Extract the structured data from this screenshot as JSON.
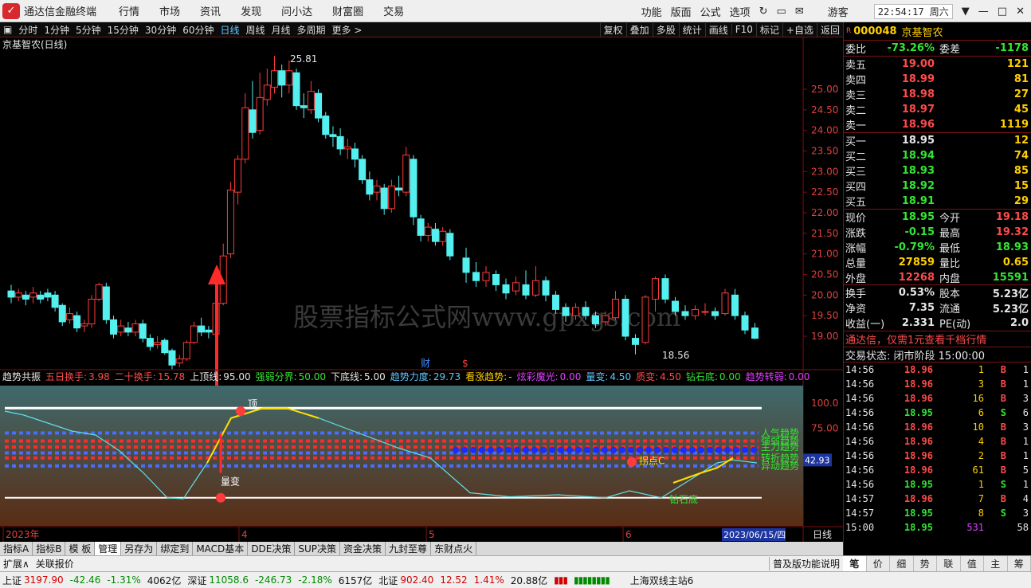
{
  "app": {
    "title": "通达信金融终端",
    "menu": [
      "行情",
      "市场",
      "资讯",
      "发现",
      "问小达",
      "财富圈",
      "交易"
    ],
    "right_menu": [
      "功能",
      "版面",
      "公式",
      "选项"
    ],
    "user": "游客",
    "clock": "22:54:17 周六"
  },
  "toolbar": {
    "periods": [
      "分时",
      "1分钟",
      "5分钟",
      "15分钟",
      "30分钟",
      "60分钟",
      "日线",
      "周线",
      "月线",
      "多周期",
      "更多 >"
    ],
    "active": "日线",
    "right": [
      "复权",
      "叠加",
      "多股",
      "统计",
      "画线",
      "F10",
      "标记",
      "+自选",
      "返回"
    ]
  },
  "chart": {
    "title": "京基智农(日线)",
    "watermark": "股票指标公式网www.gpxgs.com",
    "high_label": "25.81",
    "low_label": "18.56",
    "y_ticks": [
      "25.00",
      "24.50",
      "24.00",
      "23.50",
      "23.00",
      "22.50",
      "22.00",
      "21.50",
      "21.00",
      "20.50",
      "20.00",
      "19.50",
      "19.00"
    ],
    "markers": [
      "财",
      "$"
    ],
    "x_labels": [
      "2023年",
      "4",
      "5",
      "6"
    ],
    "date_box": "2023/06/15/四",
    "period": "日线"
  },
  "indicator": {
    "name": "趋势共振",
    "params": [
      {
        "label": "五日换手:",
        "value": "3.98",
        "color": "#ff4b4b"
      },
      {
        "label": "二十换手:",
        "value": "15.78",
        "color": "#ff4b4b"
      },
      {
        "label": "上顶线:",
        "value": "95.00",
        "color": "#e6e6e6"
      },
      {
        "label": "强弱分界:",
        "value": "50.00",
        "color": "#33e633"
      },
      {
        "label": "下底线:",
        "value": "5.00",
        "color": "#e6e6e6"
      },
      {
        "label": "趋势力度:",
        "value": "29.73",
        "color": "#5ec8ff"
      },
      {
        "label": "看涨趋势:",
        "value": "-",
        "color": "#ffd000"
      },
      {
        "label": "炫彩魔光:",
        "value": "0.00",
        "color": "#e040ff"
      },
      {
        "label": "量变:",
        "value": "4.50",
        "color": "#5ec8ff"
      },
      {
        "label": "质变:",
        "value": "4.50",
        "color": "#ff4b4b"
      },
      {
        "label": "钻石底:",
        "value": "0.00",
        "color": "#33e633"
      },
      {
        "label": "趋势转弱:",
        "value": "0.00",
        "color": "#e040ff"
      }
    ],
    "y_ticks": [
      "100.0",
      "75.00",
      "42.93"
    ],
    "labels": {
      "top": "顶",
      "liangbian": "量变",
      "guaidian": "拐点C",
      "zuanshi": "钻石底"
    },
    "right_labels": [
      "人气趋势",
      "强弱趋势",
      "主力趋势",
      "转折趋势",
      "异动趋势"
    ]
  },
  "quote": {
    "code": "000048",
    "name": "京基智农",
    "weibi": "-73.26%",
    "weicha": "-1178",
    "asks": [
      {
        "l": "卖五",
        "p": "19.00",
        "v": "121"
      },
      {
        "l": "卖四",
        "p": "18.99",
        "v": "81"
      },
      {
        "l": "卖三",
        "p": "18.98",
        "v": "27"
      },
      {
        "l": "卖二",
        "p": "18.97",
        "v": "45"
      },
      {
        "l": "卖一",
        "p": "18.96",
        "v": "1119"
      }
    ],
    "bids": [
      {
        "l": "买一",
        "p": "18.95",
        "v": "12"
      },
      {
        "l": "买二",
        "p": "18.94",
        "v": "74"
      },
      {
        "l": "买三",
        "p": "18.93",
        "v": "85"
      },
      {
        "l": "买四",
        "p": "18.92",
        "v": "15"
      },
      {
        "l": "买五",
        "p": "18.91",
        "v": "29"
      }
    ],
    "stats": [
      {
        "a": "现价",
        "av": "18.95",
        "ac": "grn",
        "b": "今开",
        "bv": "19.18",
        "bc": "red"
      },
      {
        "a": "涨跌",
        "av": "-0.15",
        "ac": "grn",
        "b": "最高",
        "bv": "19.32",
        "bc": "red"
      },
      {
        "a": "涨幅",
        "av": "-0.79%",
        "ac": "grn",
        "b": "最低",
        "bv": "18.93",
        "bc": "grn"
      },
      {
        "a": "总量",
        "av": "27859",
        "ac": "yel",
        "b": "量比",
        "bv": "0.65",
        "bc": "yel"
      },
      {
        "a": "外盘",
        "av": "12268",
        "ac": "red",
        "b": "内盘",
        "bv": "15591",
        "bc": "grn"
      },
      {
        "a": "换手",
        "av": "0.53%",
        "ac": "wht",
        "b": "股本",
        "bv": "5.23亿",
        "bc": "wht"
      },
      {
        "a": "净资",
        "av": "7.35",
        "ac": "wht",
        "b": "流通",
        "bv": "5.23亿",
        "bc": "wht"
      },
      {
        "a": "收益(一)",
        "av": "2.331",
        "ac": "wht",
        "b": "PE(动)",
        "bv": "2.0",
        "bc": "wht"
      }
    ],
    "ad": "通达信，仅需1元查看千档行情",
    "state": "交易状态: 闭市阶段 15:00:00",
    "ticks": [
      {
        "t": "14:56",
        "p": "18.96",
        "q": "1",
        "d": "B",
        "n": "1"
      },
      {
        "t": "14:56",
        "p": "18.96",
        "q": "3",
        "d": "B",
        "n": "1"
      },
      {
        "t": "14:56",
        "p": "18.96",
        "q": "16",
        "d": "B",
        "n": "3"
      },
      {
        "t": "14:56",
        "p": "18.95",
        "q": "6",
        "d": "S",
        "n": "6"
      },
      {
        "t": "14:56",
        "p": "18.96",
        "q": "10",
        "d": "B",
        "n": "3"
      },
      {
        "t": "14:56",
        "p": "18.96",
        "q": "4",
        "d": "B",
        "n": "1"
      },
      {
        "t": "14:56",
        "p": "18.96",
        "q": "2",
        "d": "B",
        "n": "1"
      },
      {
        "t": "14:56",
        "p": "18.96",
        "q": "61",
        "d": "B",
        "n": "5"
      },
      {
        "t": "14:56",
        "p": "18.95",
        "q": "1",
        "d": "S",
        "n": "1"
      },
      {
        "t": "14:57",
        "p": "18.96",
        "q": "7",
        "d": "B",
        "n": "4"
      },
      {
        "t": "14:57",
        "p": "18.95",
        "q": "8",
        "d": "S",
        "n": "3"
      },
      {
        "t": "15:00",
        "p": "18.95",
        "q": "531",
        "d": "",
        "n": "58"
      }
    ],
    "tabs": [
      "笔",
      "价",
      "细",
      "势",
      "联",
      "值",
      "主",
      "筹"
    ]
  },
  "bottom_tabs": [
    "指标A",
    "指标B",
    "模 板",
    "管理",
    "另存为",
    "绑定到",
    "MACD基本",
    "DDE决策",
    "SUP决策",
    "资金决策",
    "九封至尊",
    "东财点火"
  ],
  "bottom_active": "管理",
  "ext": {
    "left": [
      "扩展∧",
      "关联报价"
    ],
    "right": "普及版功能说明"
  },
  "status": {
    "sh": "上证",
    "sh_val": "3197.90",
    "sh_chg": "-42.46",
    "sh_pct": "-1.31%",
    "sh_amt": "4062亿",
    "sz": "深证",
    "sz_val": "11058.6",
    "sz_chg": "-246.73",
    "sz_pct": "-2.18%",
    "sz_amt": "6157亿",
    "nb": "北证",
    "nb_val": "902.40",
    "nb_chg": "12.52",
    "nb_pct": "1.41%",
    "nb_amt": "20.88亿",
    "site": "上海双线主站6"
  }
}
